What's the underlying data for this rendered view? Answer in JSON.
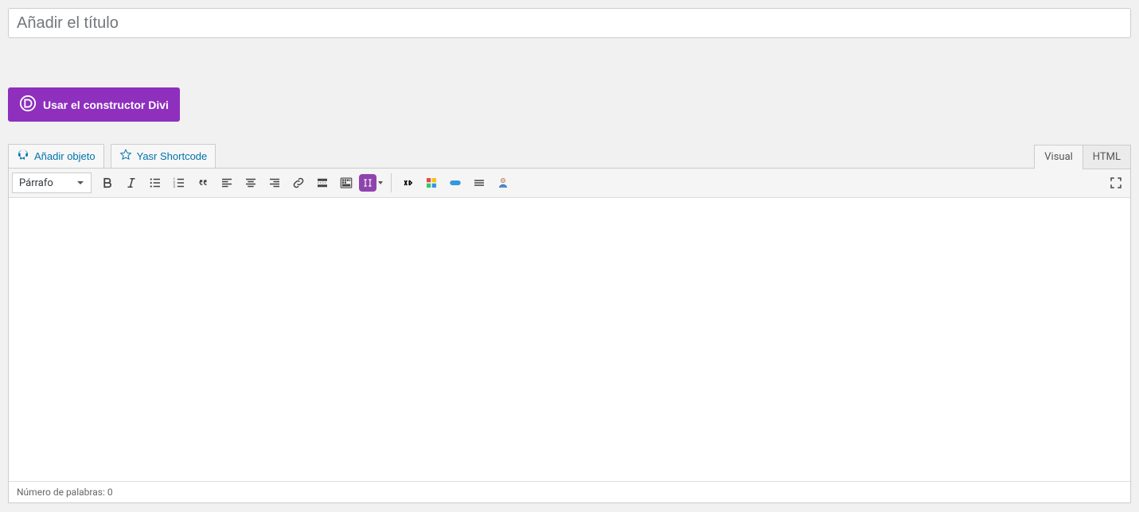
{
  "title_placeholder": "Añadir el título",
  "divi_button_label": "Usar el constructor Divi",
  "add_media_label": "Añadir objeto",
  "yasr_label": "Yasr Shortcode",
  "tabs": {
    "visual": "Visual",
    "html": "HTML"
  },
  "format_label": "Párrafo",
  "word_count_label": "Número de palabras: 0"
}
